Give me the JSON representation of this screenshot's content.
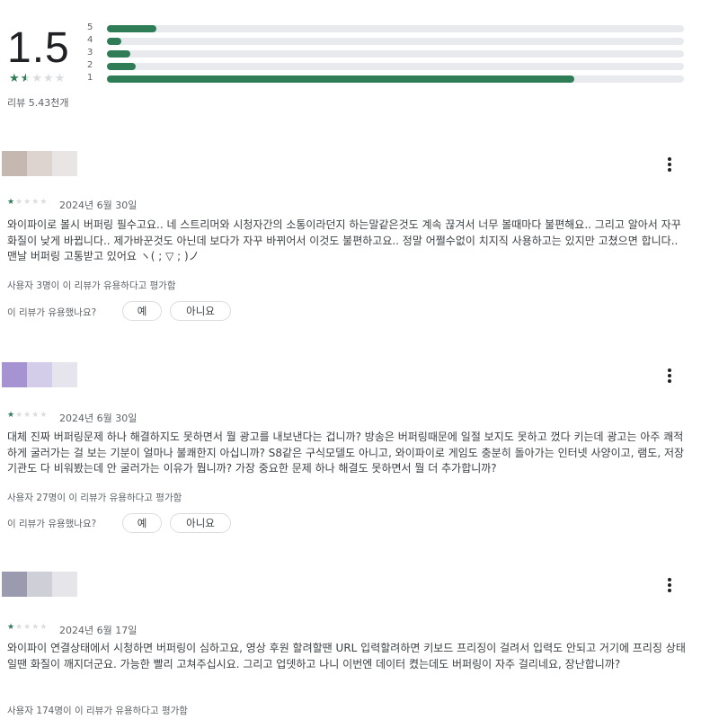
{
  "summary": {
    "rating": "1.5",
    "review_count": "리뷰 5.43천개",
    "stars": 1.5,
    "bars": [
      {
        "label": "5",
        "fraction": 0.085
      },
      {
        "label": "4",
        "fraction": 0.025
      },
      {
        "label": "3",
        "fraction": 0.04
      },
      {
        "label": "2",
        "fraction": 0.05
      },
      {
        "label": "1",
        "fraction": 0.81
      }
    ]
  },
  "colors": {
    "accent": "#2e7d57",
    "track": "#e8eaed"
  },
  "reviews": [
    {
      "avatar_colors": [
        "#c5b8b0",
        "#ddd4cf",
        "#e8e5e4"
      ],
      "stars": 1,
      "date": "2024년 6월 30일",
      "text": "와이파이로 볼시 버퍼링 필수고요.. 네 스트리머와 시청자간의 소통이라던지 하는말같은것도 계속 끊겨서 너무 볼때마다 불편해요.. 그리고 알아서 자꾸 화질이 낮게 바뀝니다.. 제가바꾼것도 아닌데 보다가 자꾸 바뀌어서 이것도 불편하고요.. 정말 어쩔수없이 치지직 사용하고는 있지만 고쳤으면 합니다.. 맨날 버퍼링 고통받고 있어요 ヽ( ; ▽ ; )ノ",
      "helpful": "사용자 3명이 이 리뷰가 유용하다고 평가함",
      "question": "이 리뷰가 유용했나요?",
      "yes": "예",
      "no": "아니요"
    },
    {
      "avatar_colors": [
        "#a594d1",
        "#d4cdea",
        "#e6e4ec"
      ],
      "stars": 1,
      "date": "2024년 6월 30일",
      "text": "대체 진짜 버퍼링문제 하나 해결하지도 못하면서 뭘 광고를 내보낸다는 겁니까? 방송은 버퍼링때문에 일절 보지도 못하고 껐다 키는데 광고는 아주 쾌적하게 굴러가는 걸 보는 기분이 얼마나 불쾌한지 아십니까? S8같은 구식모델도 아니고, 와이파이로 게임도 충분히 돌아가는 인터넷 사양이고, 램도, 저장기관도 다 비워봤는데 안 굴러가는 이유가 뭡니까? 가장 중요한 문제 하나 해결도 못하면서 뭘 더 추가합니까?",
      "helpful": "사용자 27명이 이 리뷰가 유용하다고 평가함",
      "question": "이 리뷰가 유용했나요?",
      "yes": "예",
      "no": "아니요"
    },
    {
      "avatar_colors": [
        "#9b9bb0",
        "#cfcfd8",
        "#e6e6ea"
      ],
      "stars": 1,
      "date": "2024년 6월 17일",
      "text": "와이파이 연결상태에서 시청하면 버퍼링이 심하고요, 영상 후원 할려할땐 URL 입력할려하면 키보드 프리징이 걸려서 입력도 안되고 거기에 프리징 상태일땐 화질이 깨지더군요. 가능한 빨리 고쳐주십시요. 그리고 업뎃하고 나니 이번엔 데이터 켰는데도 버퍼링이 자주 걸리네요, 장난합니까?",
      "helpful": "사용자 174명이 이 리뷰가 유용하다고 평가함"
    }
  ]
}
